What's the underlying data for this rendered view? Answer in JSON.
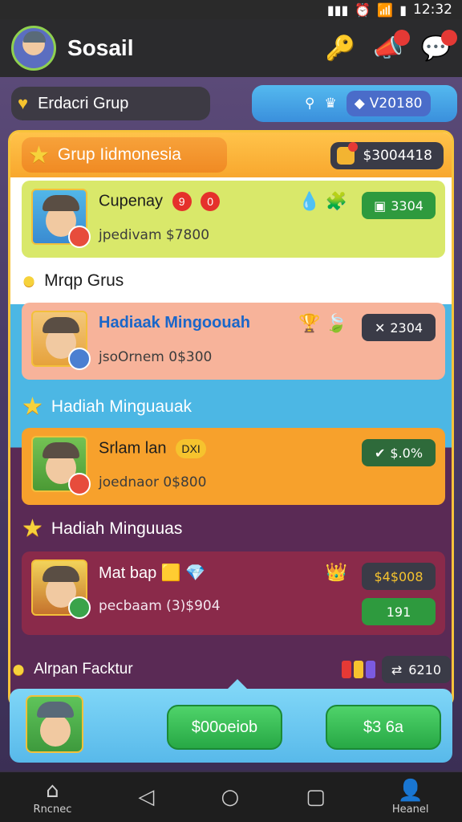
{
  "status_bar": {
    "time": "12:32"
  },
  "app_bar": {
    "title": "Sosail",
    "icons": [
      "key-icon",
      "notification-icon",
      "chat-icon"
    ]
  },
  "filter": {
    "label": "Erdacri Grup",
    "currency_value": "V20180"
  },
  "group": {
    "title": "Grup Iidmonesia",
    "amount": "$3004418"
  },
  "cards": [
    {
      "name": "Cupenay",
      "badges": [
        "9",
        "0"
      ],
      "sub": "jpedivam $7800",
      "value": "3304",
      "bg": "#d9e86a",
      "value_bg": "#2e9a3e"
    },
    {
      "name": "Hadiaak Mingoouah",
      "sub": "jsoOrnem 0$300",
      "value": "2304",
      "bg": "#f7b39a",
      "value_bg": "#3a3b47"
    },
    {
      "name": "Srlam lan",
      "badge": "DXI",
      "sub": "joednaor 0$800",
      "value": "$.0%",
      "bg": "#f7a12c",
      "value_bg": "#2e6a3a"
    },
    {
      "name": "Mat bap",
      "sub": "pecbaam (3)$904",
      "value": "$4$008",
      "value2": "191",
      "bg": "#8a2a4a",
      "value_bg": "#3a3b47"
    }
  ],
  "sections": {
    "s1": "Mrqp Grus",
    "s2": "Hadiah Minguauak",
    "s3": "Hadiah Minguuas",
    "s4": "Alrpan Facktur"
  },
  "bottom_currency": "6210",
  "footer": {
    "btn1": "$00oeiob",
    "btn2": "$3 6a"
  },
  "nav": {
    "home": "Rncnec",
    "profile": "Heanel"
  }
}
